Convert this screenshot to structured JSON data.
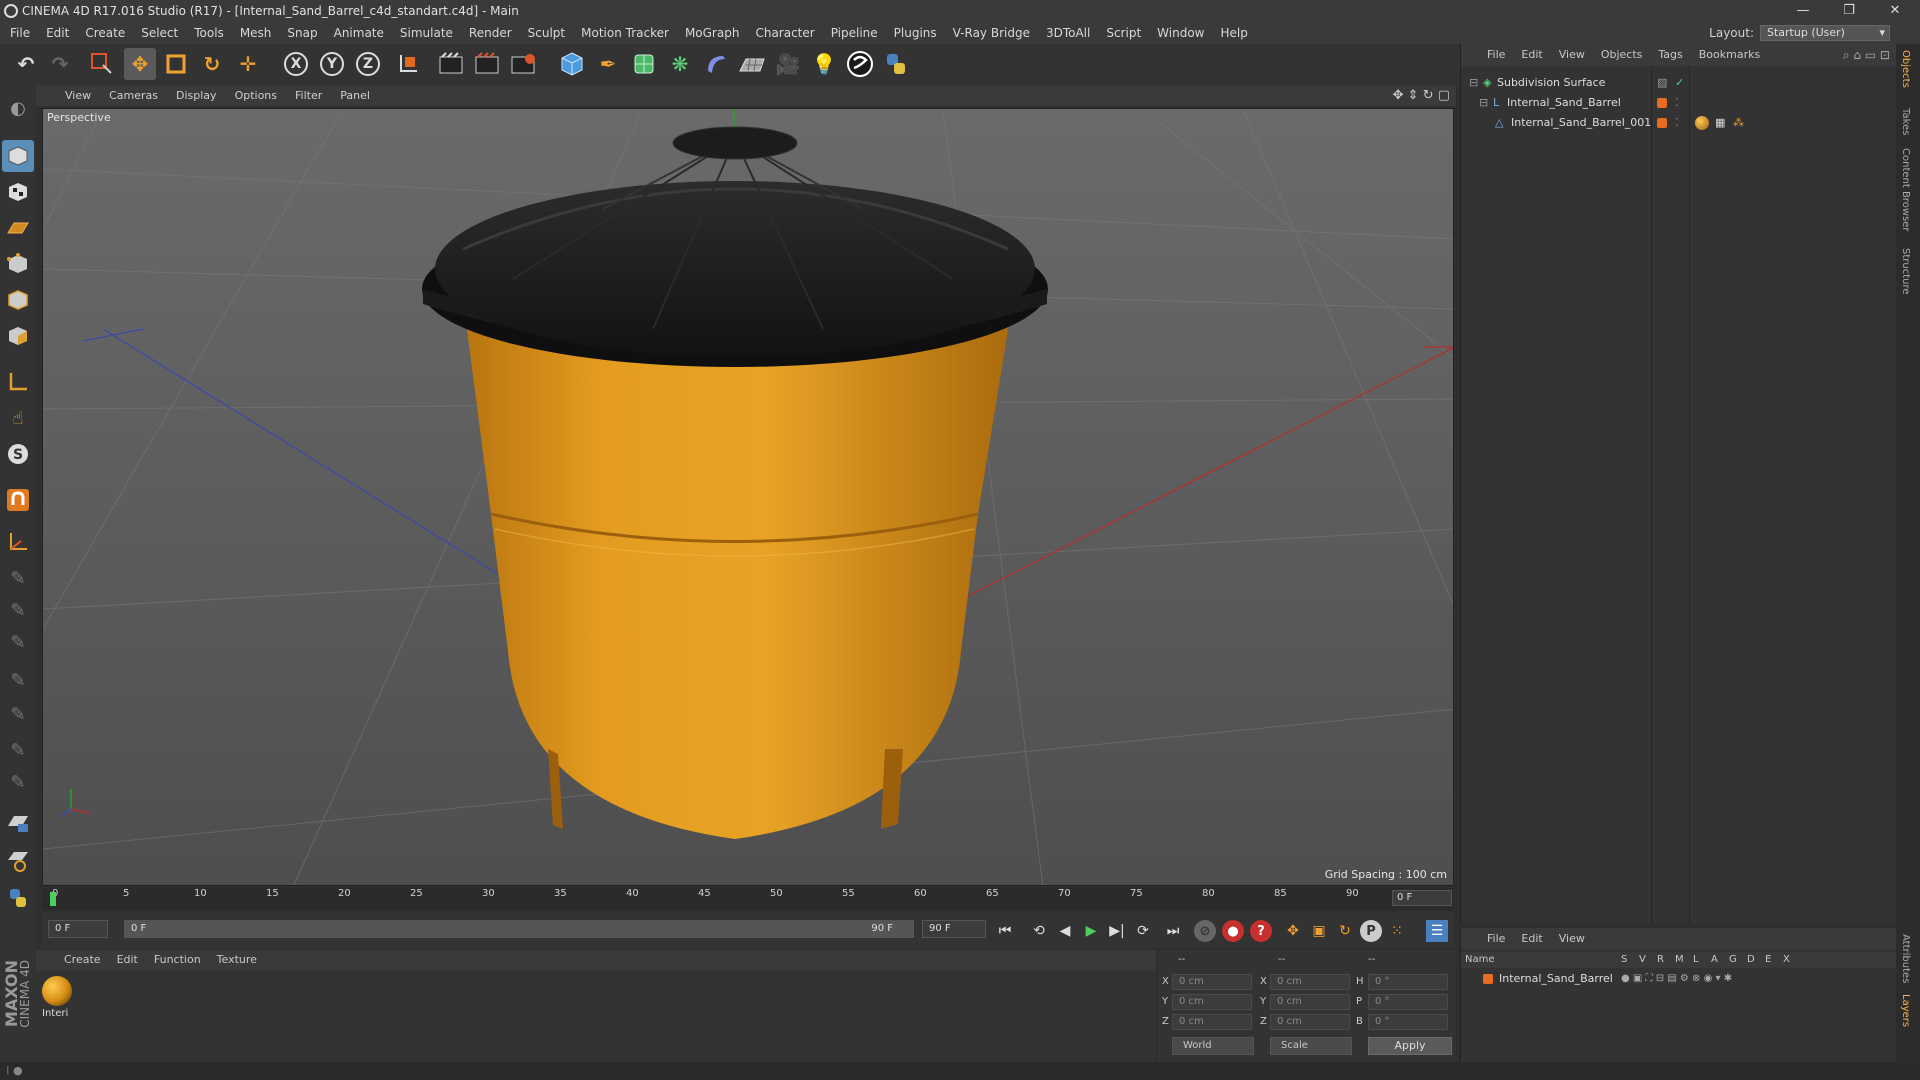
{
  "window": {
    "title": "CINEMA 4D R17.016 Studio (R17) - [Internal_Sand_Barrel_c4d_standart.c4d] - Main",
    "minimize": "—",
    "restore": "❐",
    "close": "✕"
  },
  "menubar": {
    "items": [
      "File",
      "Edit",
      "Create",
      "Select",
      "Tools",
      "Mesh",
      "Snap",
      "Animate",
      "Simulate",
      "Render",
      "Sculpt",
      "Motion Tracker",
      "MoGraph",
      "Character",
      "Pipeline",
      "Plugins",
      "V-Ray Bridge",
      "3DToAll",
      "Script",
      "Window",
      "Help"
    ],
    "layout_label": "Layout:",
    "layout_value": "Startup (User)"
  },
  "toolbar": {
    "axis_x": "X",
    "axis_y": "Y",
    "axis_z": "Z",
    "icons": [
      "undo-icon",
      "redo-icon",
      "live-select-icon",
      "move-icon",
      "scale-icon",
      "rotate-icon",
      "transform-icon",
      "coordinate-system-icon",
      "render-view-icon",
      "render-picture-viewer-icon",
      "edit-render-settings-icon",
      "cube-icon",
      "spline-pen-icon",
      "subdivision-icon",
      "cloner-icon",
      "deformer-icon",
      "floor-icon",
      "camera-icon",
      "light-icon",
      "vray-icon",
      "python-icon"
    ]
  },
  "viewport": {
    "menu": [
      "View",
      "Cameras",
      "Display",
      "Options",
      "Filter",
      "Panel"
    ],
    "label": "Perspective",
    "grid_spacing": "Grid Spacing : 100 cm"
  },
  "timeline": {
    "ticks": [
      "0",
      "5",
      "10",
      "15",
      "20",
      "25",
      "30",
      "35",
      "40",
      "45",
      "50",
      "55",
      "60",
      "65",
      "70",
      "75",
      "80",
      "85",
      "90"
    ],
    "current_frame": "0 F"
  },
  "transport": {
    "start_frame": "0 F",
    "range_start": "0 F",
    "range_end": "90 F",
    "end_frame": "90 F"
  },
  "material_manager": {
    "menu": [
      "Create",
      "Edit",
      "Function",
      "Texture"
    ],
    "materials": [
      {
        "name": "Interi"
      }
    ]
  },
  "coordinates": {
    "header_1": "--",
    "header_2": "--",
    "header_3": "--",
    "rows": [
      {
        "label": "X",
        "pos": "0 cm",
        "size_label": "X",
        "size": "0 cm",
        "rot_label": "H",
        "rot": "0 °"
      },
      {
        "label": "Y",
        "pos": "0 cm",
        "size_label": "Y",
        "size": "0 cm",
        "rot_label": "P",
        "rot": "0 °"
      },
      {
        "label": "Z",
        "pos": "0 cm",
        "size_label": "Z",
        "size": "0 cm",
        "rot_label": "B",
        "rot": "0 °"
      }
    ],
    "mode_world": "World",
    "mode_scale": "Scale",
    "apply": "Apply"
  },
  "object_manager": {
    "menu": [
      "File",
      "Edit",
      "View",
      "Objects",
      "Tags",
      "Bookmarks"
    ],
    "objects": [
      {
        "name": "Subdivision Surface"
      },
      {
        "name": "Internal_Sand_Barrel"
      },
      {
        "name": "Internal_Sand_Barrel_001"
      }
    ]
  },
  "layer_manager": {
    "menu": [
      "File",
      "Edit",
      "View"
    ],
    "columns": [
      "Name",
      "S",
      "V",
      "R",
      "M",
      "L",
      "A",
      "G",
      "D",
      "E",
      "X"
    ],
    "layers": [
      {
        "name": "Internal_Sand_Barrel",
        "color": "#e86b22"
      }
    ]
  },
  "side_tabs": [
    "Objects",
    "Takes",
    "Content Browser",
    "Structure",
    "Attributes",
    "Layers"
  ],
  "brand": {
    "maxon": "MAXON",
    "cinema": "CINEMA 4D"
  },
  "colors": {
    "accent": "#5b8fb8",
    "barrel": "#e09a1c",
    "lid": "#1e1e1e",
    "layer": "#e86b22"
  }
}
